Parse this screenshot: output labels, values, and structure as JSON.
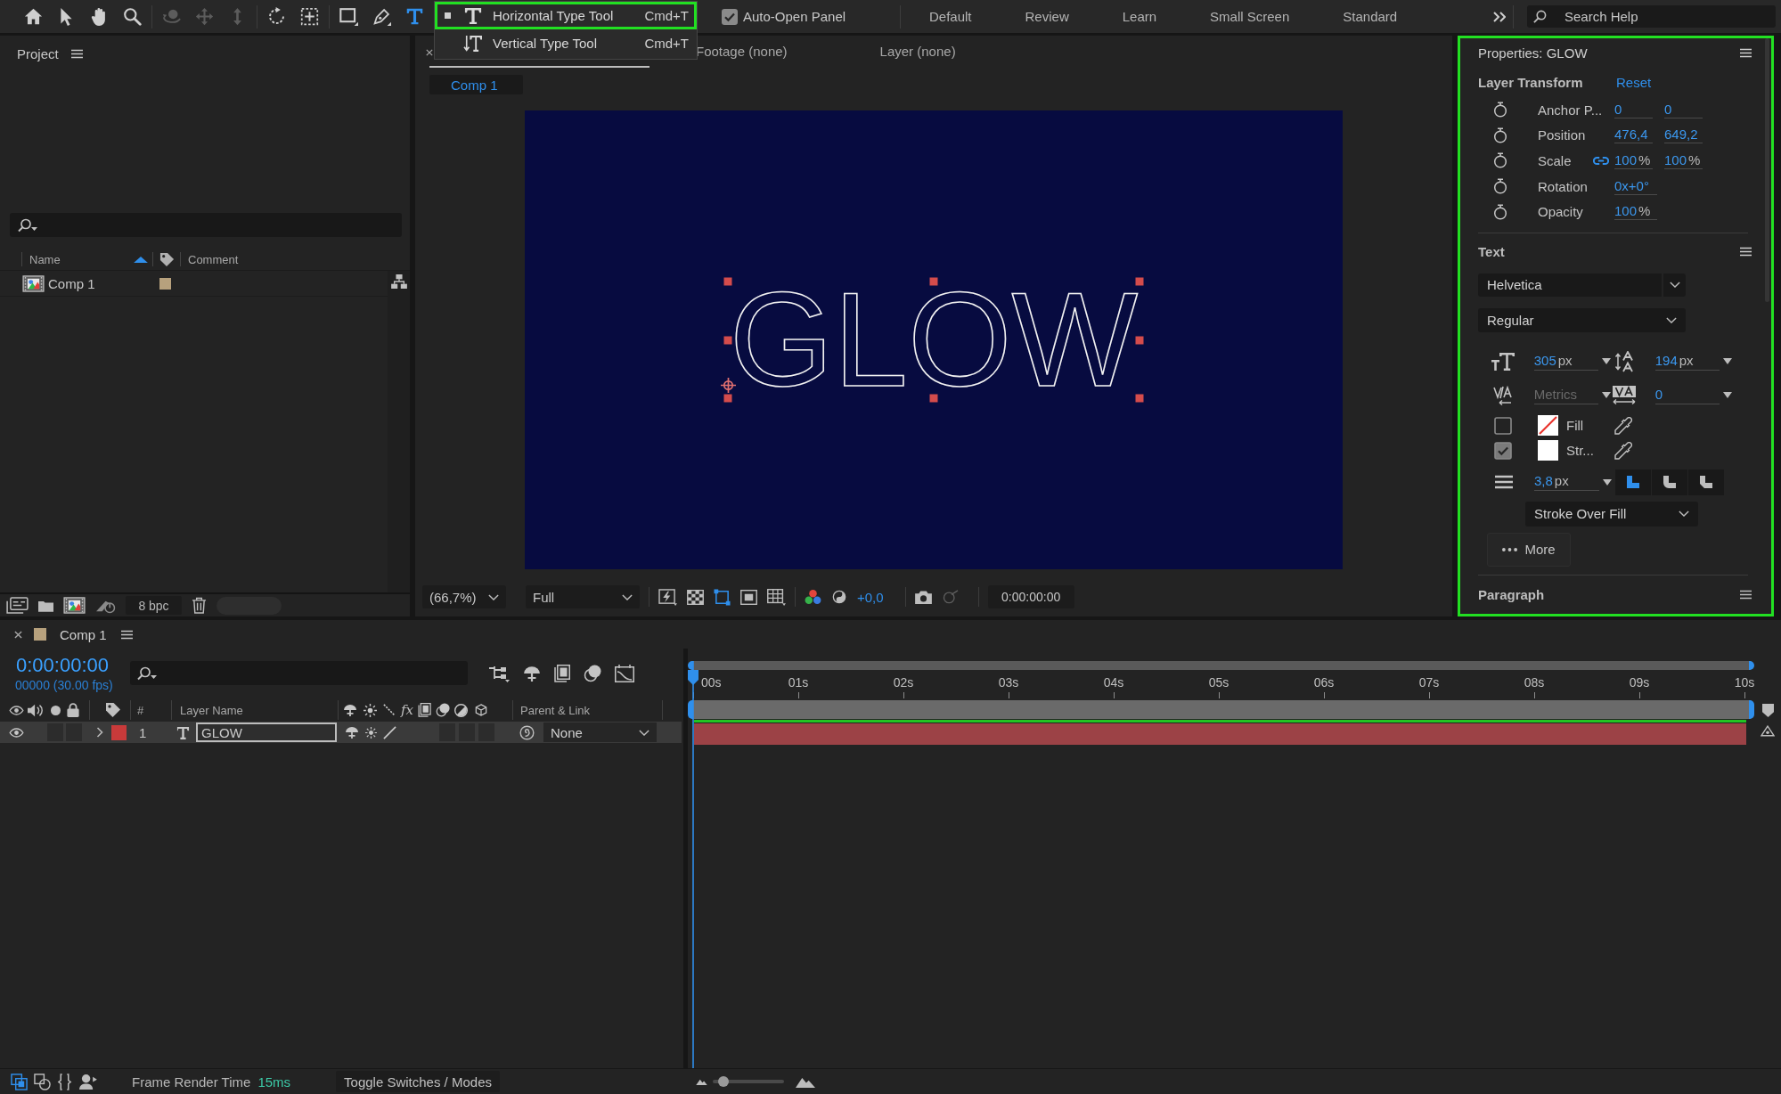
{
  "toolbar": {
    "tool_groups": [
      [
        {
          "kind": "home",
          "selected": false,
          "disabled": false
        },
        {
          "kind": "selection",
          "selected": false,
          "disabled": false
        },
        {
          "kind": "hand",
          "selected": false,
          "disabled": false
        },
        {
          "kind": "zoom",
          "selected": false,
          "disabled": false
        }
      ],
      [
        {
          "kind": "orbit",
          "selected": false,
          "disabled": true
        },
        {
          "kind": "pan",
          "selected": false,
          "disabled": true
        },
        {
          "kind": "dolly",
          "selected": false,
          "disabled": true
        }
      ],
      [
        {
          "kind": "rotate",
          "selected": false,
          "disabled": false
        },
        {
          "kind": "pan_behind",
          "selected": false,
          "disabled": false
        }
      ],
      [
        {
          "kind": "rectangle",
          "selected": false,
          "disabled": false
        },
        {
          "kind": "pen",
          "selected": false,
          "disabled": false
        },
        {
          "kind": "type",
          "selected": true,
          "disabled": false
        }
      ]
    ],
    "type_menu": [
      {
        "kind": "horizontal",
        "label": "Horizontal Type Tool",
        "shortcut": "Cmd+T",
        "selected": true,
        "highlighted": true
      },
      {
        "kind": "vertical",
        "label": "Vertical Type Tool",
        "shortcut": "Cmd+T",
        "selected": false,
        "highlighted": false
      }
    ],
    "auto_open_panel": {
      "label": "Auto-Open Panel",
      "checked": true
    },
    "workspaces": [
      {
        "label": "Default",
        "selected": false
      },
      {
        "label": "Review",
        "selected": false
      },
      {
        "label": "Learn",
        "selected": false
      },
      {
        "label": "Small Screen",
        "selected": false
      },
      {
        "label": "Standard",
        "selected": false
      }
    ],
    "search_help": {
      "placeholder": "Search Help"
    }
  },
  "project": {
    "title": "Project",
    "columns": [
      {
        "kind": "text",
        "label": "Name",
        "sorted": true
      },
      {
        "kind": "tag"
      },
      {
        "kind": "text",
        "label": "Comment"
      }
    ],
    "items": [
      {
        "kind": "composition",
        "name": "Comp 1",
        "color": "#b7a17d",
        "selected": false
      }
    ],
    "bit_depth": "8 bpc"
  },
  "viewer": {
    "tabs": [
      {
        "selected": true
      },
      {
        "label": "Footage (none)",
        "selected": false
      },
      {
        "label": "Layer (none)",
        "selected": false
      }
    ],
    "breadcrumb": "Comp 1",
    "canvas": {
      "text": "GLOW",
      "selected": true
    },
    "magnification": "(66,7%)",
    "resolution": "Full",
    "exposure": "+0,0",
    "timecode": "0:00:00:00"
  },
  "properties": {
    "title": "Properties: GLOW",
    "highlighted": true,
    "transform": {
      "title": "Layer Transform",
      "reset": "Reset",
      "rows": [
        {
          "label": "Anchor P...",
          "values": [
            {
              "value": "0"
            },
            {
              "value": "0"
            }
          ]
        },
        {
          "label": "Position",
          "values": [
            {
              "value": "476,4"
            },
            {
              "value": "649,2"
            }
          ]
        },
        {
          "label": "Scale",
          "linked": true,
          "values": [
            {
              "value": "100",
              "unit": "%"
            },
            {
              "value": "100",
              "unit": "%"
            }
          ]
        },
        {
          "label": "Rotation",
          "values": [
            {
              "value": "0x+0°"
            }
          ]
        },
        {
          "label": "Opacity",
          "values": [
            {
              "value": "100",
              "unit": "%"
            }
          ]
        }
      ]
    },
    "text": {
      "title": "Text",
      "font": "Helvetica",
      "style": "Regular",
      "metrics": [
        {
          "kind": "size",
          "value": "305",
          "unit": "px",
          "disabled": false
        },
        {
          "kind": "leading",
          "value": "194",
          "unit": "px",
          "disabled": false
        },
        {
          "kind": "kerning",
          "value": "Metrics",
          "disabled": true
        },
        {
          "kind": "tracking",
          "value": "0",
          "disabled": false
        }
      ],
      "paints": [
        {
          "label": "Fill",
          "checked": false,
          "no_color": true
        },
        {
          "label": "Str...",
          "checked": true,
          "no_color": false,
          "color": "#ffffff"
        }
      ],
      "stroke_width": {
        "value": "3,8",
        "unit": "px"
      },
      "joins": [
        {
          "kind": "miter",
          "selected": true
        },
        {
          "kind": "round",
          "selected": false
        },
        {
          "kind": "bevel",
          "selected": false
        }
      ],
      "stroke_order": "Stroke Over Fill",
      "more": "More"
    },
    "paragraph": {
      "title": "Paragraph"
    }
  },
  "timeline": {
    "tab": {
      "label": "Comp 1",
      "color": "#b7a17d"
    },
    "timecode": "0:00:00:00",
    "frame_info": "00000 (30.00 fps)",
    "headers": {
      "number": "#",
      "layer_name": "Layer Name",
      "effects": "fx",
      "parent": "Parent & Link"
    },
    "layers": [
      {
        "kind": "text",
        "number": "1",
        "name": "GLOW",
        "color": "#c83a3a",
        "visible": true,
        "expanded": false,
        "selected": true,
        "editing": true,
        "parent": "None"
      }
    ],
    "ruler": [
      "00s",
      "01s",
      "02s",
      "03s",
      "04s",
      "05s",
      "06s",
      "07s",
      "08s",
      "09s",
      "10s"
    ],
    "status": {
      "label": "Frame Render Time",
      "value": "15ms",
      "toggle": "Toggle Switches / Modes",
      "zoom": {
        "level": 0.15
      }
    }
  }
}
